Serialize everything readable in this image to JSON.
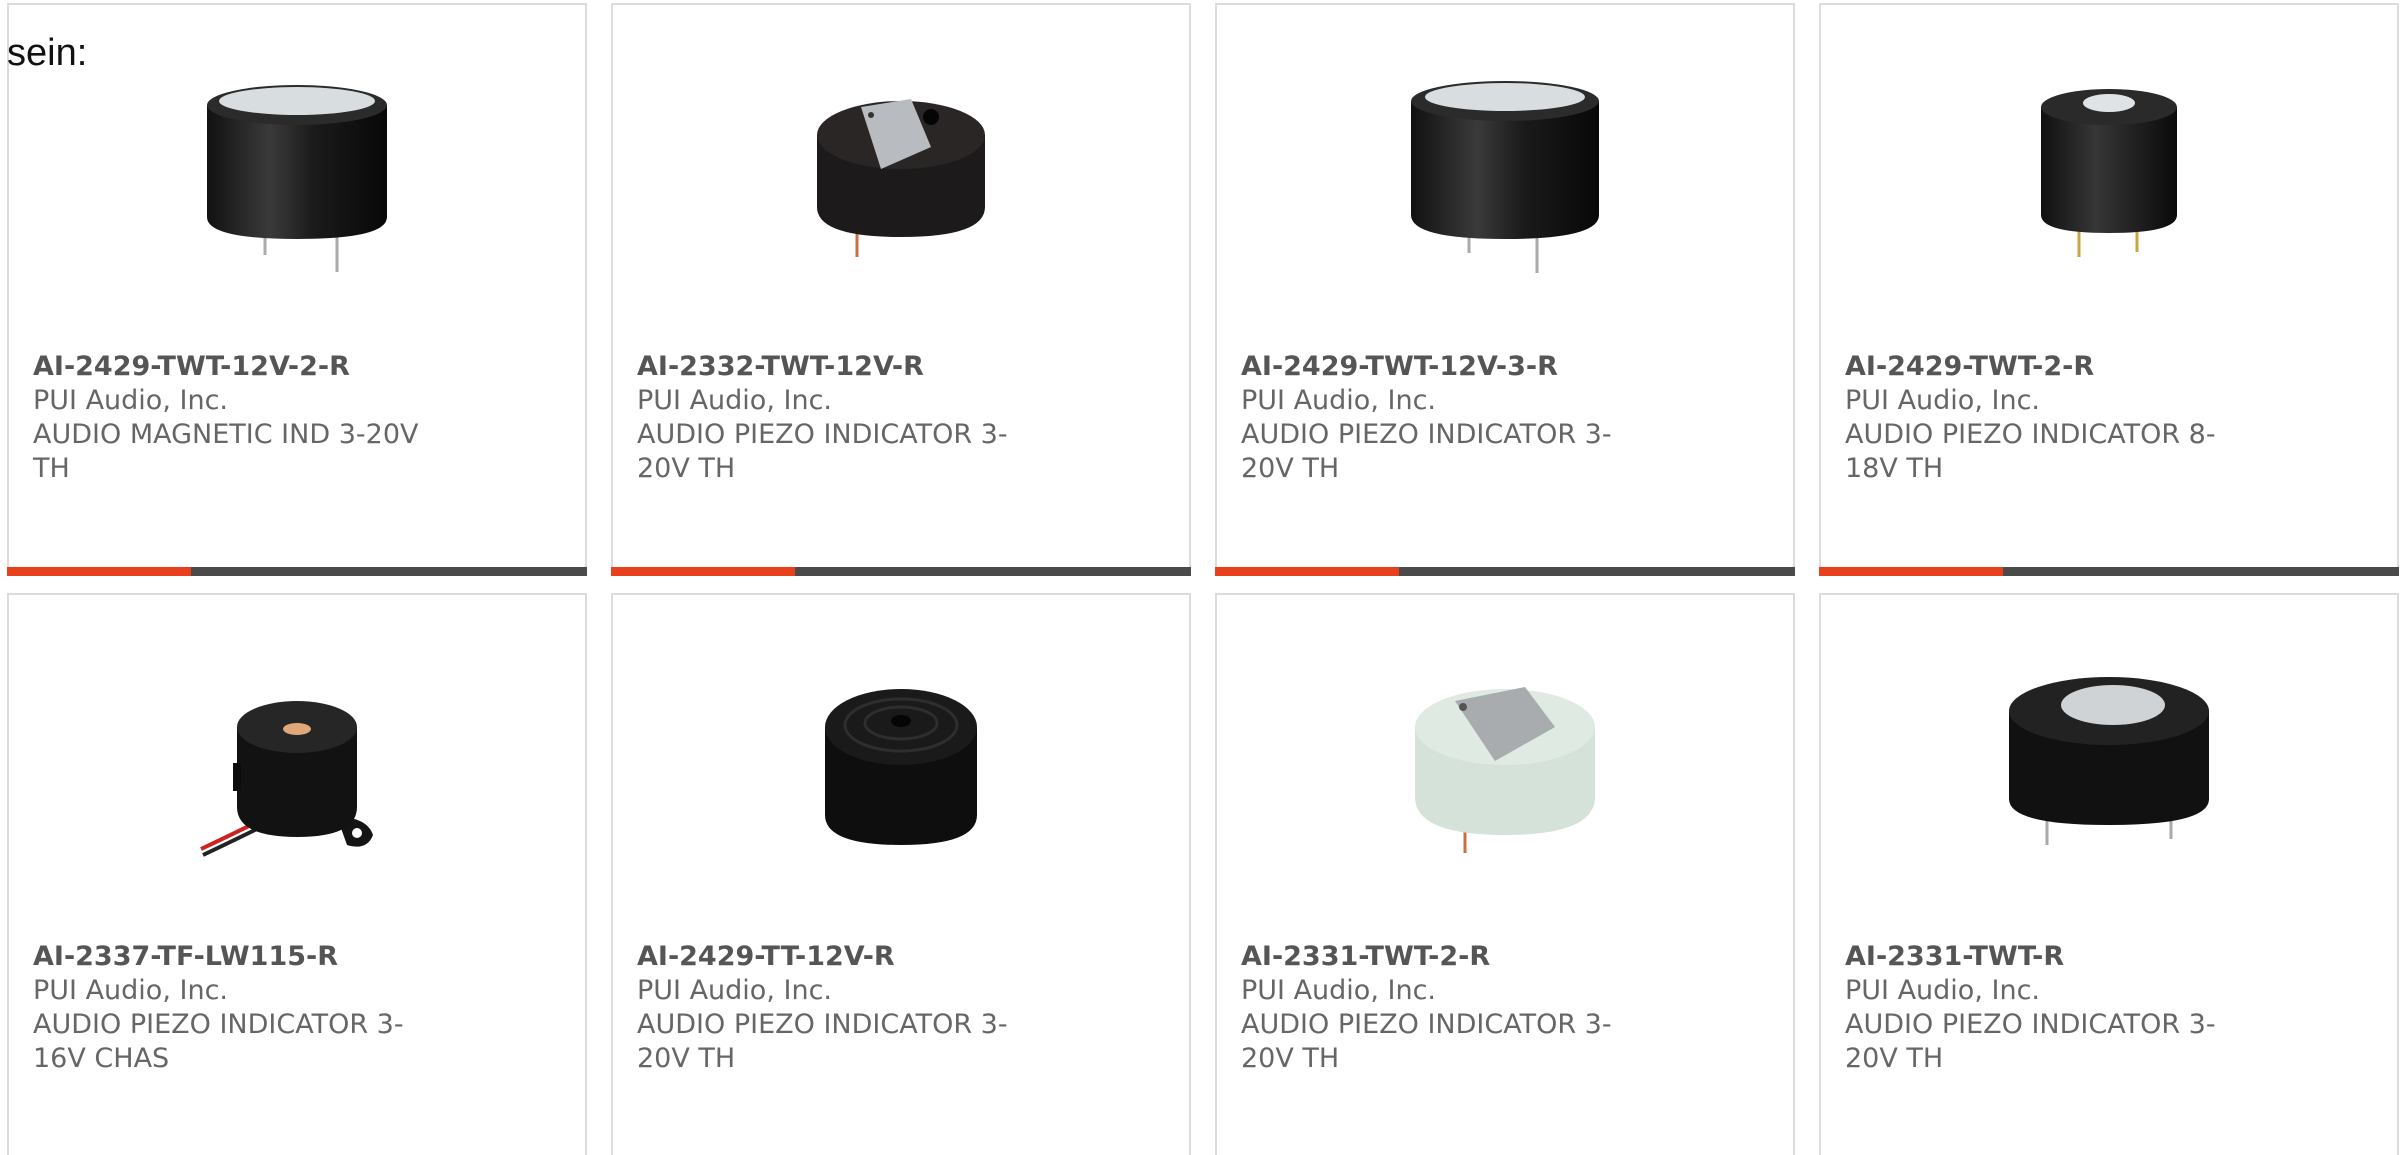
{
  "intro_text": "sein:",
  "colors": {
    "accent": "#e8401c",
    "bar": "#4a4a4a",
    "border": "#dcdcdc",
    "text": "#666666"
  },
  "products": [
    {
      "part": "AI-2429-TWT-12V-2-R",
      "maker": "PUI Audio, Inc.",
      "desc": "AUDIO MAGNETIC IND 3-20V TH",
      "image_icon": "buzzer-tall-black-image"
    },
    {
      "part": "AI-2332-TWT-12V-R",
      "maker": "PUI Audio, Inc.",
      "desc": "AUDIO PIEZO INDICATOR 3-20V TH",
      "image_icon": "buzzer-textured-black-image"
    },
    {
      "part": "AI-2429-TWT-12V-3-R",
      "maker": "PUI Audio, Inc.",
      "desc": "AUDIO PIEZO INDICATOR 3-20V TH",
      "image_icon": "buzzer-tall-black-image"
    },
    {
      "part": "AI-2429-TWT-2-R",
      "maker": "PUI Audio, Inc.",
      "desc": "AUDIO PIEZO INDICATOR 8-18V TH",
      "image_icon": "buzzer-narrow-black-image"
    },
    {
      "part": "AI-2337-TF-LW115-R",
      "maker": "PUI Audio, Inc.",
      "desc": "AUDIO PIEZO INDICATOR 3-16V CHAS",
      "image_icon": "buzzer-wired-flange-image"
    },
    {
      "part": "AI-2429-TT-12V-R",
      "maker": "PUI Audio, Inc.",
      "desc": "AUDIO PIEZO INDICATOR 3-20V TH",
      "image_icon": "buzzer-ribbed-black-image"
    },
    {
      "part": "AI-2331-TWT-2-R",
      "maker": "PUI Audio, Inc.",
      "desc": "AUDIO PIEZO INDICATOR 3-20V TH",
      "image_icon": "buzzer-mint-image"
    },
    {
      "part": "AI-2331-TWT-R",
      "maker": "PUI Audio, Inc.",
      "desc": "AUDIO PIEZO INDICATOR 3-20V TH",
      "image_icon": "buzzer-wide-black-image"
    }
  ]
}
